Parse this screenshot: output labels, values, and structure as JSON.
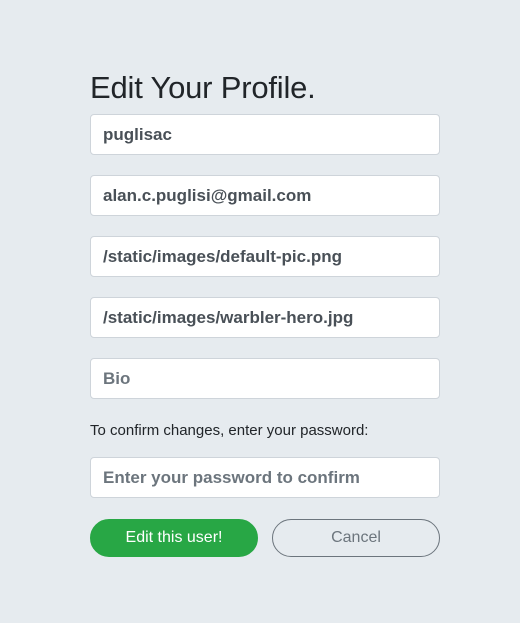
{
  "page": {
    "title": "Edit Your Profile."
  },
  "form": {
    "username": {
      "value": "puglisac",
      "placeholder": ""
    },
    "email": {
      "value": "alan.c.puglisi@gmail.com",
      "placeholder": ""
    },
    "image_url": {
      "value": "/static/images/default-pic.png",
      "placeholder": ""
    },
    "header_image_url": {
      "value": "/static/images/warbler-hero.jpg",
      "placeholder": ""
    },
    "bio": {
      "value": "",
      "placeholder": "Bio"
    },
    "confirm_text": "To confirm changes, enter your password:",
    "password": {
      "value": "",
      "placeholder": "Enter your password to confirm"
    }
  },
  "actions": {
    "submit_label": "Edit this user!",
    "cancel_label": "Cancel"
  },
  "colors": {
    "background": "#e6ebef",
    "primary": "#28a745",
    "secondary": "#6c757d"
  }
}
